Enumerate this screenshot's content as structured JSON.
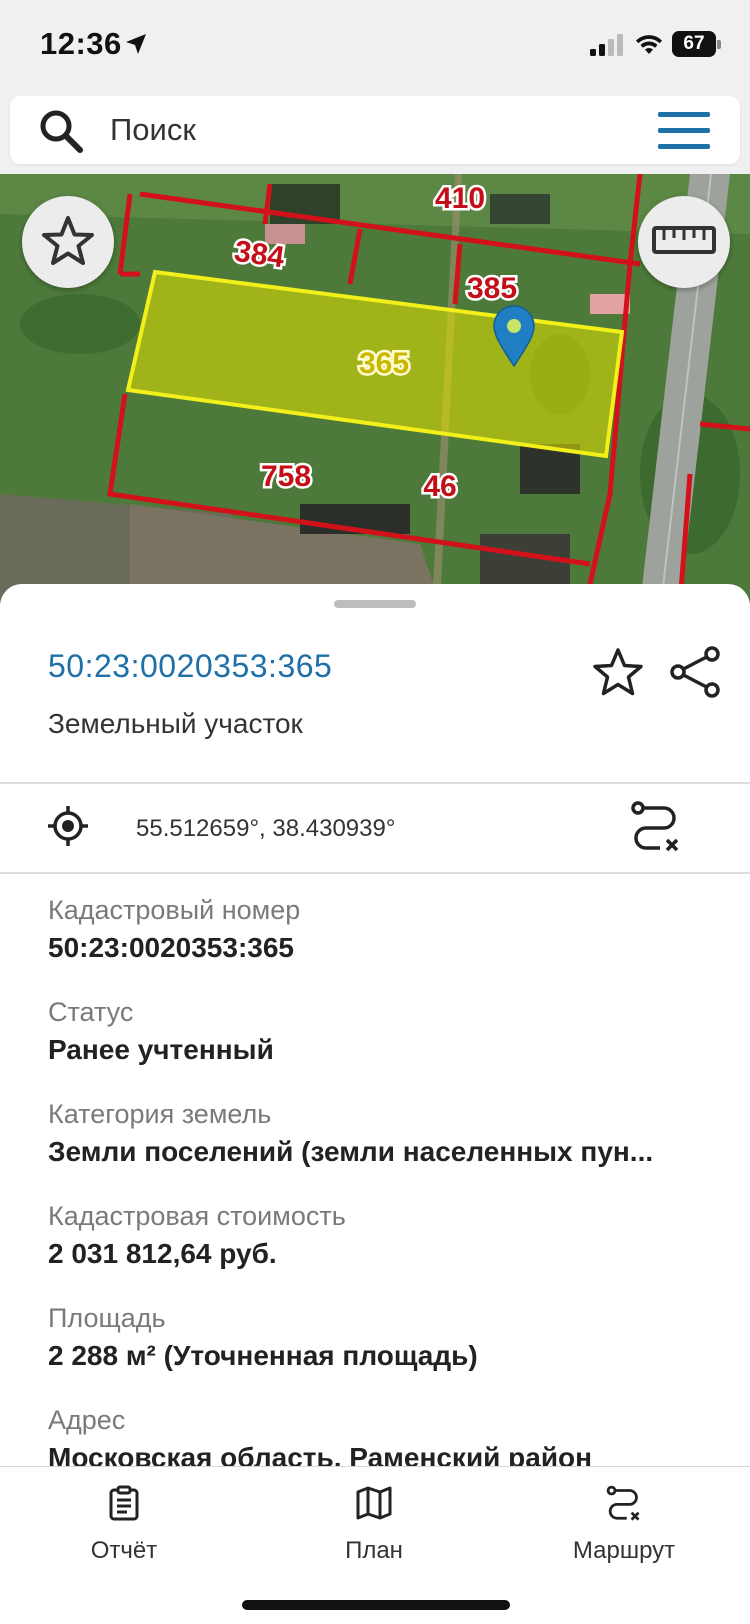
{
  "status_bar": {
    "time": "12:36",
    "battery": "67"
  },
  "search": {
    "placeholder": "Поиск"
  },
  "map": {
    "parcel_labels": [
      "410",
      "384",
      "385",
      "365",
      "758",
      "46"
    ],
    "highlight_color": "#e6e400",
    "boundary_color": "#d3111b",
    "marker_color": "#1f7fc2"
  },
  "parcel": {
    "id": "50:23:0020353:365",
    "type": "Земельный участок",
    "coordinates": "55.512659°, 38.430939°"
  },
  "details": [
    {
      "label": "Кадастровый номер",
      "value": "50:23:0020353:365"
    },
    {
      "label": "Статус",
      "value": "Ранее учтенный"
    },
    {
      "label": "Категория земель",
      "value": "Земли поселений (земли населенных пун..."
    },
    {
      "label": "Кадастровая стоимость",
      "value": "2 031 812,64 руб."
    },
    {
      "label": "Площадь",
      "value": "2 288 м² (Уточненная площадь)"
    },
    {
      "label": "Адрес",
      "value": "Московская область, Раменский район"
    }
  ],
  "tabs": [
    {
      "label": "Отчёт",
      "icon": "report-icon"
    },
    {
      "label": "План",
      "icon": "map-icon"
    },
    {
      "label": "Маршрут",
      "icon": "route-icon"
    }
  ],
  "colors": {
    "accent": "#1f6fa8"
  }
}
